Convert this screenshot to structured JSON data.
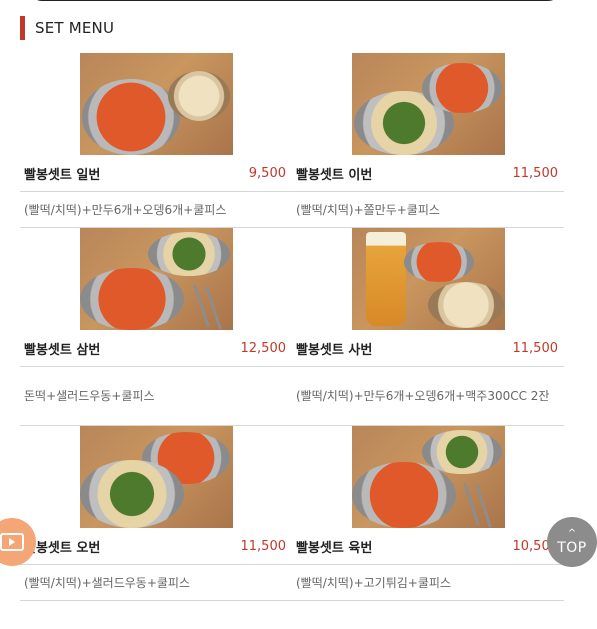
{
  "section": {
    "title": "SET MENU"
  },
  "menu": [
    {
      "name": "빨봉셋트 일번",
      "price": "9,500",
      "desc": "(빨떡/치떡)+만두6개+오뎅6개+쿨피스"
    },
    {
      "name": "빨봉셋트 이번",
      "price": "11,500",
      "desc": "(빨떡/치떡)+쫄만두+쿨피스"
    },
    {
      "name": "빨봉셋트 삼번",
      "price": "12,500",
      "desc": "돈떡+샐러드우동+쿨피스"
    },
    {
      "name": "빨봉셋트 사번",
      "price": "11,500",
      "desc": "(빨떡/치떡)+만두6개+오뎅6개+맥주300CC 2잔"
    },
    {
      "name": "빨봉셋트 오번",
      "price": "11,500",
      "desc": "(빨떡/치떡)+샐러드우동+쿨피스"
    },
    {
      "name": "빨봉셋트 육번",
      "price": "10,500",
      "desc": "(빨떡/치떡)+고기튀김+쿨피스"
    }
  ],
  "floating": {
    "top_label": "TOP",
    "top_chevron": "^"
  },
  "colors": {
    "accent": "#c0392b",
    "price": "#c0392b",
    "tv_button": "#f5a676",
    "top_button": "#8c8c8c"
  },
  "icons": {
    "tv": "tv-play-icon",
    "top": "chevron-up-icon"
  }
}
